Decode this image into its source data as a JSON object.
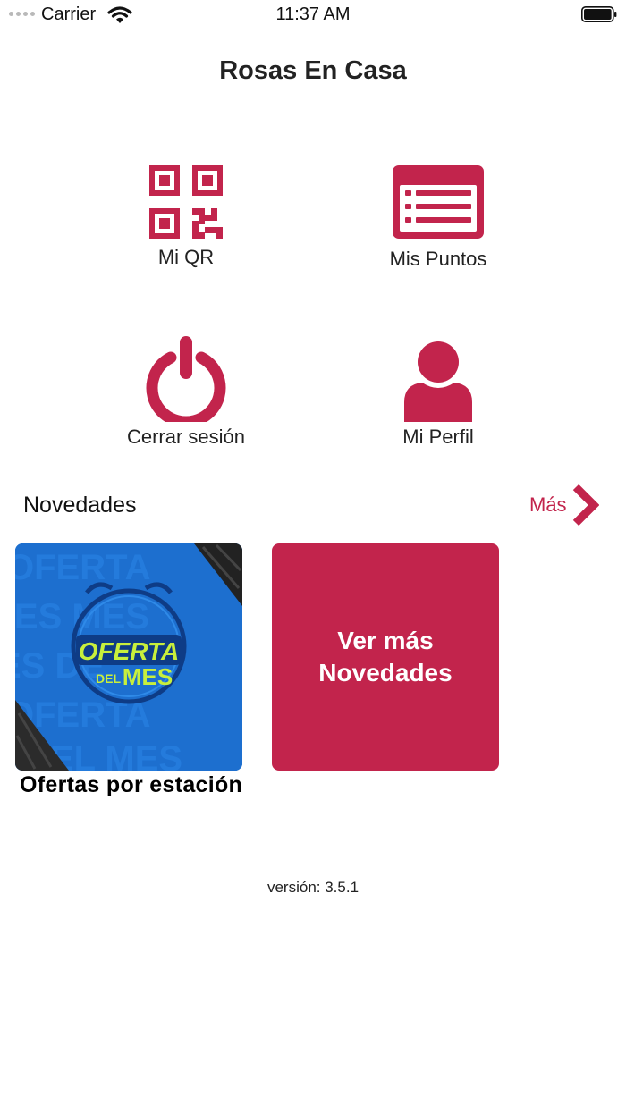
{
  "status": {
    "carrier": "Carrier",
    "time": "11:37 AM"
  },
  "app": {
    "title": "Rosas En Casa"
  },
  "menu": {
    "qr_label": "Mi QR",
    "points_label": "Mis Puntos",
    "logout_label": "Cerrar sesión",
    "profile_label": "Mi Perfil"
  },
  "news": {
    "heading": "Novedades",
    "more_label": "Más",
    "card1_badge_top": "OFERTA",
    "card1_badge_bottom_small": "DEL",
    "card1_badge_bottom_big": "MES",
    "card1_caption": "Ofertas por estación",
    "card2_text_line1": "Ver más",
    "card2_text_line2": "Novedades"
  },
  "footer": {
    "version": "versión: 3.5.1"
  },
  "colors": {
    "accent": "#c2244c",
    "card_blue": "#1d6fcf",
    "badge_green": "#c8ef3c"
  }
}
